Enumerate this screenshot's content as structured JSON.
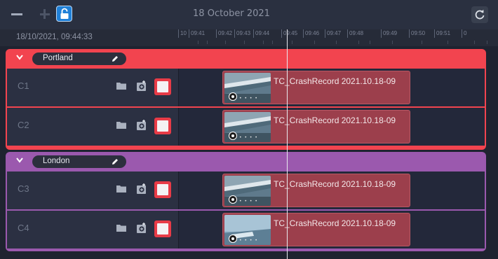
{
  "toolbar": {
    "date": "18 October 2021",
    "icons": [
      "minus-icon",
      "plus-icon",
      "unlock-icon",
      "refresh-icon"
    ]
  },
  "timeline": {
    "timestamp": "18/10/2021, 09:44:33",
    "ticks": [
      "10",
      "09:41",
      "09:42",
      "09:43",
      "09:44",
      "09:45",
      "09:46",
      "09:47",
      "09:48",
      "09:49",
      "09:50",
      "09:51",
      "0"
    ],
    "colors": {
      "portland": "#f2444f",
      "london": "#9b59ae",
      "clip": "#9c3f4c",
      "playhead": "#e8eaf0"
    }
  },
  "groups": [
    {
      "name": "Portland",
      "channels": [
        {
          "name": "C1",
          "clip_title": "TC_CrashRecord 2021.10.18-09",
          "thumb_dots": "• • • •"
        },
        {
          "name": "C2",
          "clip_title": "TC_CrashRecord 2021.10.18-09",
          "thumb_dots": "• • • •"
        }
      ]
    },
    {
      "name": "London",
      "channels": [
        {
          "name": "C3",
          "clip_title": "TC_CrashRecord 2021.10.18-09",
          "thumb_dots": "• • • •"
        },
        {
          "name": "C4",
          "clip_title": "TC_CrashRecord 2021.10.18-09",
          "thumb_dots": "• • • •"
        }
      ]
    }
  ]
}
